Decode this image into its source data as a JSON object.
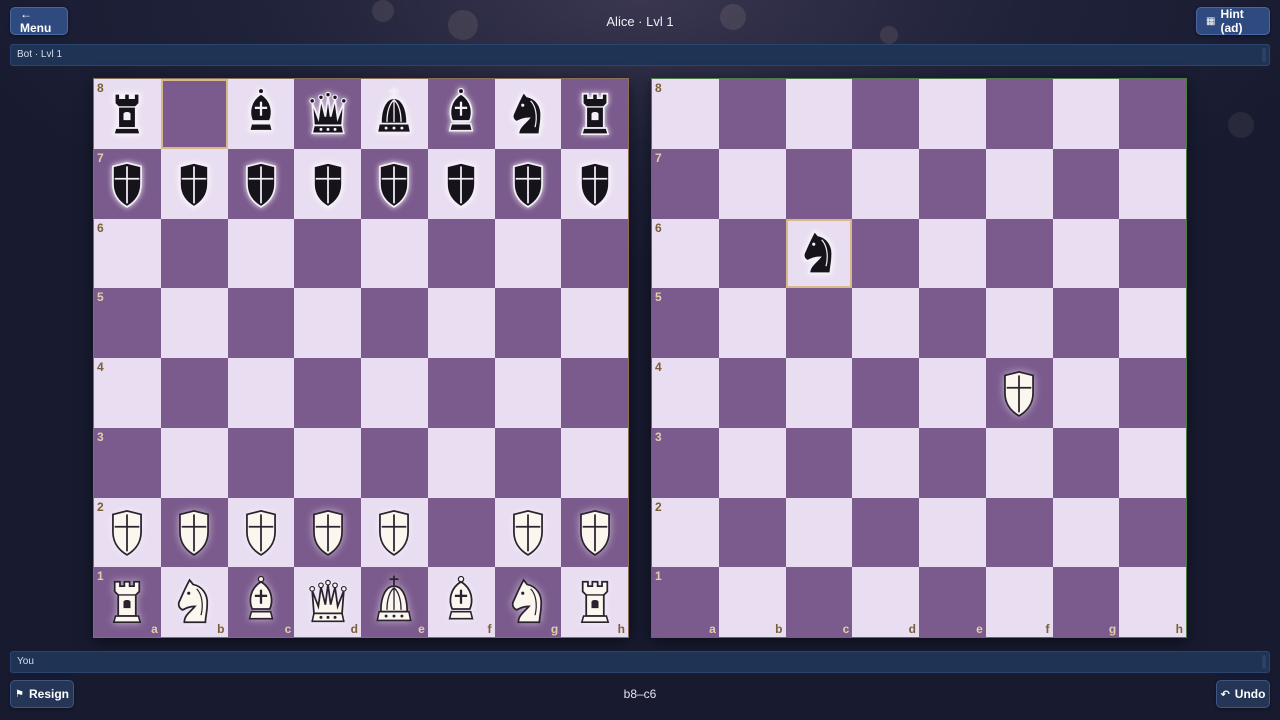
{
  "header": {
    "menu_label": "← Menu",
    "title": "Alice · Lvl 1",
    "hint_label": "Hint (ad)"
  },
  "opponent_bar": {
    "label": "Bot · Lvl 1"
  },
  "player_bar": {
    "label": "You"
  },
  "footer": {
    "resign_label": "Resign",
    "last_move": "b8–c6",
    "undo_label": "Undo"
  },
  "colors": {
    "light_square": "#e9ddf1",
    "dark_square": "#7b5b8d",
    "button": "#2f4a7e"
  },
  "files": [
    "a",
    "b",
    "c",
    "d",
    "e",
    "f",
    "g",
    "h"
  ],
  "ranks": [
    "8",
    "7",
    "6",
    "5",
    "4",
    "3",
    "2",
    "1"
  ],
  "boards": [
    {
      "name": "board-left",
      "highlight": [
        "b8"
      ],
      "rows": [
        [
          "bR",
          "",
          "bB",
          "bQ",
          "bK",
          "bB",
          "bN",
          "bR"
        ],
        [
          "bP",
          "bP",
          "bP",
          "bP",
          "bP",
          "bP",
          "bP",
          "bP"
        ],
        [
          "",
          "",
          "",
          "",
          "",
          "",
          "",
          ""
        ],
        [
          "",
          "",
          "",
          "",
          "",
          "",
          "",
          ""
        ],
        [
          "",
          "",
          "",
          "",
          "",
          "",
          "",
          ""
        ],
        [
          "",
          "",
          "",
          "",
          "",
          "",
          "",
          ""
        ],
        [
          "wP",
          "wP",
          "wP",
          "wP",
          "wP",
          "",
          "wP",
          "wP"
        ],
        [
          "wR",
          "wN",
          "wB",
          "wQ",
          "wK",
          "wB",
          "wN",
          "wR"
        ]
      ]
    },
    {
      "name": "board-right",
      "highlight": [
        "c6"
      ],
      "rows": [
        [
          "",
          "",
          "",
          "",
          "",
          "",
          "",
          ""
        ],
        [
          "",
          "",
          "",
          "",
          "",
          "",
          "",
          ""
        ],
        [
          "",
          "",
          "bN",
          "",
          "",
          "",
          "",
          ""
        ],
        [
          "",
          "",
          "",
          "",
          "",
          "",
          "",
          ""
        ],
        [
          "",
          "",
          "",
          "",
          "",
          "wP",
          "",
          ""
        ],
        [
          "",
          "",
          "",
          "",
          "",
          "",
          "",
          ""
        ],
        [
          "",
          "",
          "",
          "",
          "",
          "",
          "",
          ""
        ],
        [
          "",
          "",
          "",
          "",
          "",
          "",
          "",
          ""
        ]
      ]
    }
  ]
}
